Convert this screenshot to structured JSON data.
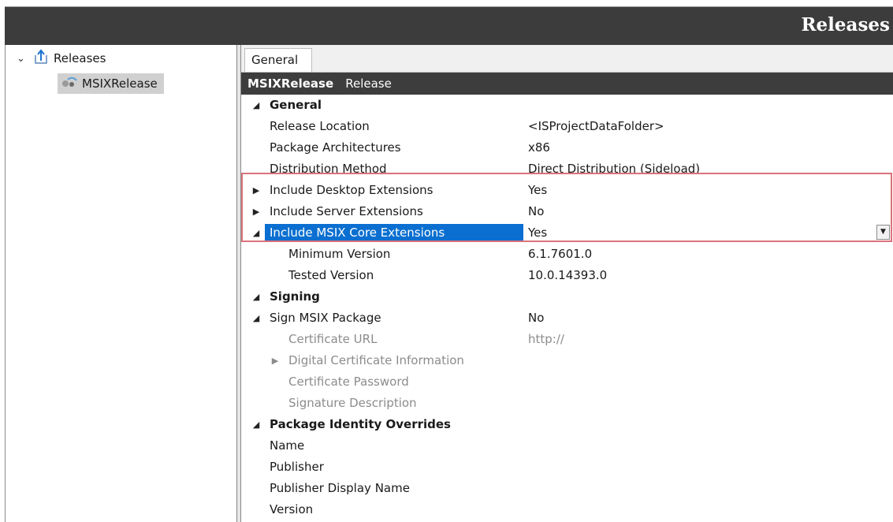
{
  "title_bar": {
    "title": "Releases"
  },
  "tree": {
    "root": {
      "label": "Releases",
      "icon": "release-upload-icon"
    },
    "child": {
      "label": "MSIXRelease",
      "icon": "msix-release-icon"
    }
  },
  "tabs": [
    {
      "label": "General"
    }
  ],
  "header": {
    "name": "MSIXRelease",
    "kind": "Release"
  },
  "colors": {
    "selection": "#0a6fd0",
    "highlight_box": "#d9737a",
    "header_bar": "#3d3d3d",
    "disabled_text": "#8c8c8c"
  },
  "properties": [
    {
      "label": "General",
      "value": "",
      "category": true,
      "expander": "expanded"
    },
    {
      "label": "Release Location",
      "value": "<ISProjectDataFolder>"
    },
    {
      "label": "Package Architectures",
      "value": "x86"
    },
    {
      "label": "Distribution Method",
      "value": "Direct Distribution (Sideload)"
    },
    {
      "label": "Include Desktop Extensions",
      "value": "Yes",
      "expander": "collapsed"
    },
    {
      "label": "Include Server Extensions",
      "value": "No",
      "expander": "collapsed"
    },
    {
      "label": "Include MSIX Core Extensions",
      "value": "Yes",
      "expander": "expanded",
      "selected": true
    },
    {
      "label": "Minimum Version",
      "value": "6.1.7601.0"
    },
    {
      "label": "Tested Version",
      "value": "10.0.14393.0"
    },
    {
      "label": "Signing",
      "value": "",
      "category": true,
      "expander": "expanded"
    },
    {
      "label": "Sign MSIX Package",
      "value": "No",
      "expander": "expanded"
    },
    {
      "label": "Certificate URL",
      "value": "http://",
      "disabled": true
    },
    {
      "label": "Digital Certificate Information",
      "value": "",
      "disabled": true,
      "expander": "collapsed"
    },
    {
      "label": "Certificate Password",
      "value": "",
      "disabled": true
    },
    {
      "label": "Signature Description",
      "value": "",
      "disabled": true
    },
    {
      "label": "Package Identity Overrides",
      "value": "",
      "category": true,
      "expander": "expanded"
    },
    {
      "label": "Name",
      "value": ""
    },
    {
      "label": "Publisher",
      "value": ""
    },
    {
      "label": "Publisher Display Name",
      "value": ""
    },
    {
      "label": "Version",
      "value": ""
    }
  ]
}
